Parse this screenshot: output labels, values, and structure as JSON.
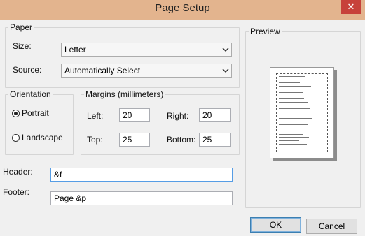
{
  "window": {
    "title": "Page Setup",
    "close_glyph": "✕"
  },
  "paper": {
    "group_label": "Paper",
    "size_label": "Size:",
    "size_value": "Letter",
    "source_label": "Source:",
    "source_value": "Automatically Select"
  },
  "orientation": {
    "group_label": "Orientation",
    "portrait_label": "Portrait",
    "landscape_label": "Landscape",
    "selected": "portrait"
  },
  "margins": {
    "group_label": "Margins (millimeters)",
    "left_label": "Left:",
    "left_value": "20",
    "right_label": "Right:",
    "right_value": "20",
    "top_label": "Top:",
    "top_value": "25",
    "bottom_label": "Bottom:",
    "bottom_value": "25"
  },
  "preview": {
    "group_label": "Preview"
  },
  "header": {
    "label": "Header:",
    "value": "&f"
  },
  "footer": {
    "label": "Footer:",
    "value": "Page &p"
  },
  "buttons": {
    "ok": "OK",
    "cancel": "Cancel"
  },
  "colors": {
    "titlebar": "#e3b48e",
    "close": "#c7413a",
    "focus": "#569de5"
  }
}
